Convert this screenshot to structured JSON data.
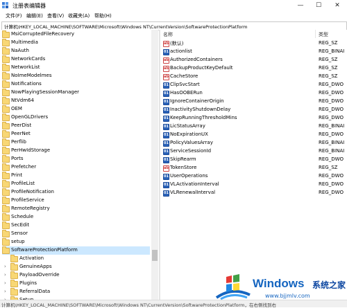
{
  "window": {
    "title": "注册表编辑器",
    "minimize_glyph": "—",
    "maximize_glyph": "☐",
    "close_glyph": "✕"
  },
  "menu": [
    "文件(F)",
    "编辑(E)",
    "查看(V)",
    "收藏夹(A)",
    "帮助(H)"
  ],
  "address": "计算机\\HKEY_LOCAL_MACHINE\\SOFTWARE\\Microsoft\\Windows NT\\CurrentVersion\\SoftwareProtectionPlatform",
  "tree": {
    "items": [
      {
        "label": "MsiCorruptedFileRecovery",
        "depth": 0
      },
      {
        "label": "Multimedia",
        "depth": 0
      },
      {
        "label": "NaAuth",
        "depth": 0
      },
      {
        "label": "NetworkCards",
        "depth": 0
      },
      {
        "label": "NetworkList",
        "depth": 0
      },
      {
        "label": "NoImeModelmes",
        "depth": 0
      },
      {
        "label": "Notifications",
        "depth": 0
      },
      {
        "label": "NowPlayingSessionManager",
        "depth": 0
      },
      {
        "label": "NtVdm64",
        "depth": 0
      },
      {
        "label": "OEM",
        "depth": 0
      },
      {
        "label": "OpenGLDrivers",
        "depth": 0
      },
      {
        "label": "PeerDist",
        "depth": 0
      },
      {
        "label": "PeerNet",
        "depth": 0
      },
      {
        "label": "Perflib",
        "depth": 0
      },
      {
        "label": "PerHwIdStorage",
        "depth": 0
      },
      {
        "label": "Ports",
        "depth": 0
      },
      {
        "label": "Prefetcher",
        "depth": 0
      },
      {
        "label": "Print",
        "depth": 0
      },
      {
        "label": "ProfileList",
        "depth": 0
      },
      {
        "label": "ProfileNotification",
        "depth": 0
      },
      {
        "label": "ProfileService",
        "depth": 0
      },
      {
        "label": "RemoteRegistry",
        "depth": 0
      },
      {
        "label": "Schedule",
        "depth": 0
      },
      {
        "label": "SecEdit",
        "depth": 0
      },
      {
        "label": "Sensor",
        "depth": 0
      },
      {
        "label": "setup",
        "depth": 0
      },
      {
        "label": "SoftwareProtectionPlatform",
        "depth": 0,
        "selected": true,
        "expanded": true
      },
      {
        "label": "Activation",
        "depth": 1
      },
      {
        "label": "GenuineApps",
        "depth": 1,
        "has_children": true
      },
      {
        "label": "PayloadOverride",
        "depth": 1,
        "has_children": true
      },
      {
        "label": "Plugins",
        "depth": 1,
        "has_children": true
      },
      {
        "label": "ReferralData",
        "depth": 1,
        "has_children": true
      },
      {
        "label": "Setup",
        "depth": 1,
        "has_children": true
      }
    ]
  },
  "values": {
    "headers": {
      "name": "名称",
      "type": "类型"
    },
    "rows": [
      {
        "name": "(默认)",
        "type": "REG_SZ",
        "kind": "sz"
      },
      {
        "name": "actionlist",
        "type": "REG_BINAI",
        "kind": "bin"
      },
      {
        "name": "AuthorizedContainers",
        "type": "REG_SZ",
        "kind": "sz"
      },
      {
        "name": "BackupProductKeyDefault",
        "type": "REG_SZ",
        "kind": "sz"
      },
      {
        "name": "CacheStore",
        "type": "REG_SZ",
        "kind": "sz"
      },
      {
        "name": "ClipSvcStart",
        "type": "REG_DWO",
        "kind": "bin"
      },
      {
        "name": "HasOOBERun",
        "type": "REG_DWO",
        "kind": "bin"
      },
      {
        "name": "IgnoreContainerOrigin",
        "type": "REG_DWO",
        "kind": "bin"
      },
      {
        "name": "InactivityShutdownDelay",
        "type": "REG_DWO",
        "kind": "bin"
      },
      {
        "name": "KeepRunningThresholdMins",
        "type": "REG_DWO",
        "kind": "bin"
      },
      {
        "name": "LicStatusArray",
        "type": "REG_BINAI",
        "kind": "bin"
      },
      {
        "name": "NoExpirationUX",
        "type": "REG_DWO",
        "kind": "bin"
      },
      {
        "name": "PolicyValuesArray",
        "type": "REG_BINAI",
        "kind": "bin"
      },
      {
        "name": "ServiceSessionId",
        "type": "REG_BINAI",
        "kind": "bin"
      },
      {
        "name": "SkipRearm",
        "type": "REG_DWO",
        "kind": "bin"
      },
      {
        "name": "TokenStore",
        "type": "REG_SZ",
        "kind": "sz"
      },
      {
        "name": "UserOperations",
        "type": "REG_DWO",
        "kind": "bin"
      },
      {
        "name": "VLActivationInterval",
        "type": "REG_DWO",
        "kind": "bin"
      },
      {
        "name": "VLRenewalInterval",
        "type": "REG_DWO",
        "kind": "bin"
      }
    ]
  },
  "status": "计算机\\HKEY_LOCAL_MACHINE\\SOFTWARE\\Microsoft\\Windows NT\\CurrentVersion\\SoftwareProtectionPlatform，在右侧找到右",
  "watermark": {
    "brand": "Windows",
    "zh": "系统之家",
    "url": "www.bjjmlv.com",
    "colors": {
      "blue": "#1565c0",
      "dark": "#0d47a1"
    }
  },
  "colors": {
    "selection": "#cce8ff",
    "folder": "#f8d775",
    "bin_icon": "#2a62b8",
    "sz_icon": "#cc3333"
  }
}
